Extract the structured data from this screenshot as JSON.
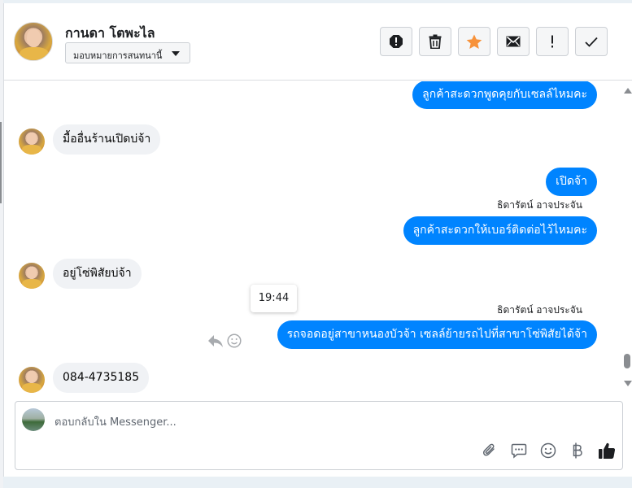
{
  "header": {
    "contact_name": "กานดา โตพะไล",
    "assign_label": "มอบหมายการสนทนานี้",
    "tools": [
      {
        "name": "spam-icon"
      },
      {
        "name": "trash-icon"
      },
      {
        "name": "star-icon"
      },
      {
        "name": "envelope-icon"
      },
      {
        "name": "exclamation-icon"
      },
      {
        "name": "check-icon"
      }
    ]
  },
  "colors": {
    "outgoing_bubble": "#0084ff",
    "incoming_bubble": "#f0f2f5",
    "star": "#f7923a"
  },
  "messages": [
    {
      "direction": "out",
      "text": "ลูกค้าสะดวกพูดคุยกับเซลล์ไหมคะ"
    },
    {
      "direction": "in",
      "text": "มื้ออื่นร้านเปิดบ่จ้า"
    },
    {
      "direction": "out",
      "text": "เปิดจ้า"
    },
    {
      "direction": "out",
      "sender": "ธิดารัตน์ อาจประจัน",
      "text": "ลูกค้าสะดวกให้เบอร์ติดต่อไว้ไหมคะ"
    },
    {
      "direction": "in",
      "text": "อยู่โซ่พิสัยบ่จ้า"
    },
    {
      "direction": "out",
      "sender": "ธิดารัตน์ อาจประจัน",
      "text": "รถจอดอยู่สาขาหนองบัวจ้า เซลล์ย้ายรถไปที่สาขาโซ่พิสัยได้จ้า"
    },
    {
      "direction": "in",
      "text": "084-4735185"
    }
  ],
  "tooltip": {
    "time": "19:44"
  },
  "composer": {
    "placeholder": "ตอบกลับใน Messenger...",
    "tools": [
      "paperclip-icon",
      "saved-replies-icon",
      "emoji-icon",
      "baht-icon",
      "thumbs-up-icon"
    ]
  }
}
